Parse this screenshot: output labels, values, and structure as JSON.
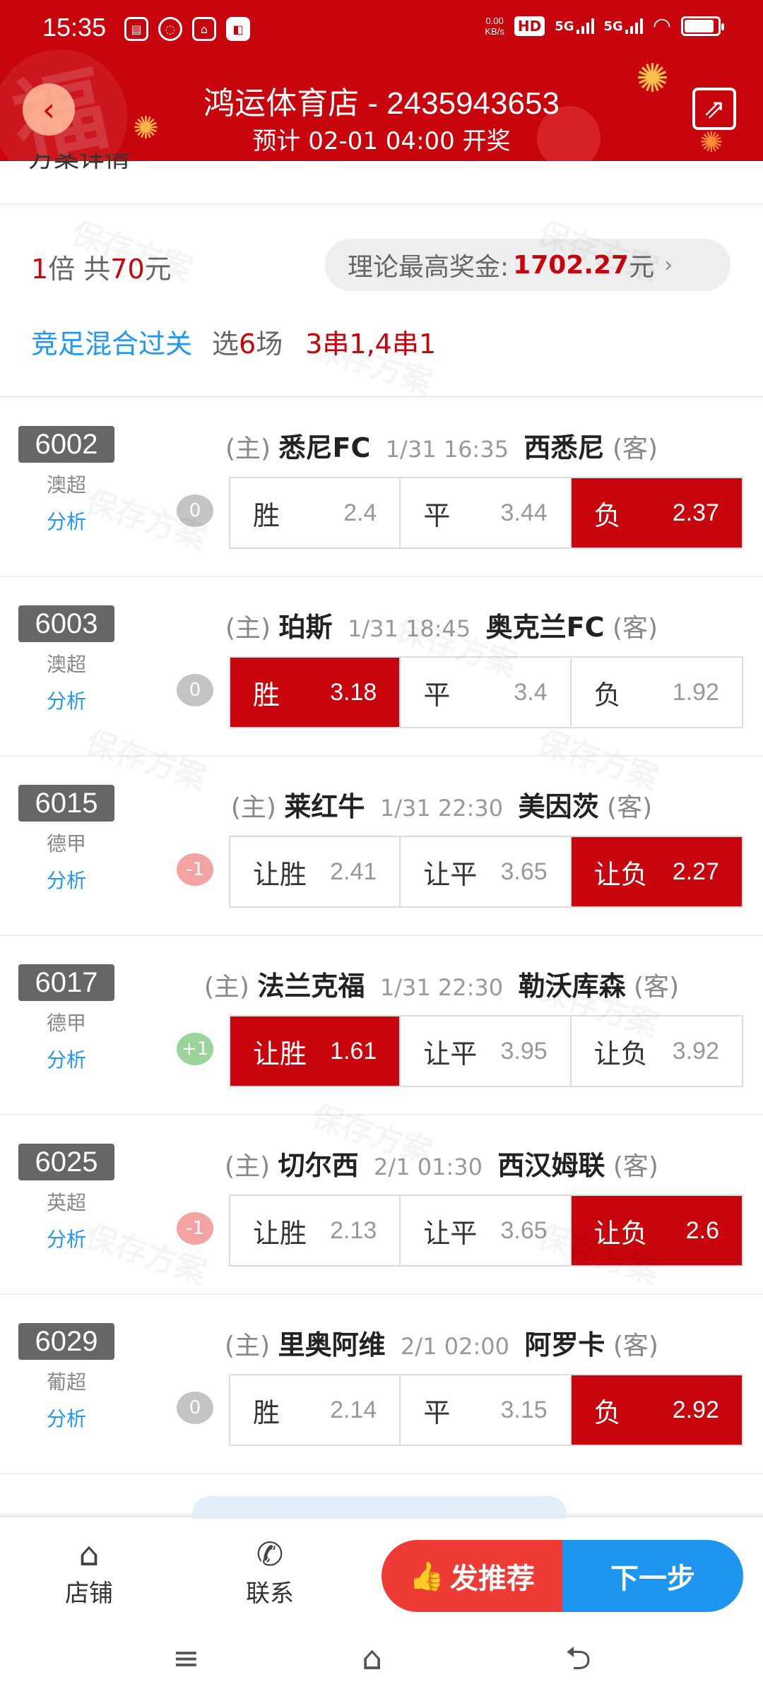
{
  "status_bar": {
    "time": "15:35",
    "speed_top": "0.00",
    "speed_bottom": "KB/s",
    "hd_label": "HD",
    "net1": "5G",
    "net2": "5G",
    "battery_percent": 90
  },
  "header": {
    "title": "鸿运体育店 - 2435943653",
    "subtitle": "预计 02-01 04:00 开奖",
    "section_cut": "方案详情"
  },
  "summary": {
    "multiplier": "1",
    "multiplier_unit": "倍 共",
    "total": "70",
    "total_unit": "元",
    "max_prize_label": "理论最高奖金:",
    "max_prize_value": "1702.27",
    "max_prize_unit": "元",
    "play_type": "竞足混合过关",
    "select_prefix": "选",
    "select_count": "6",
    "select_suffix": "场",
    "pass_type": "3串1,4串1"
  },
  "watermark": "保存方案",
  "matches": [
    {
      "code": "6002",
      "league": "澳超",
      "analysis": "分析",
      "home_tag": "(主)",
      "home": "悉尼FC",
      "time": "1/31 16:35",
      "away": "西悉尼",
      "away_tag": "(客)",
      "handicap": "0",
      "odds": [
        {
          "label": "胜",
          "value": "2.4",
          "selected": false
        },
        {
          "label": "平",
          "value": "3.44",
          "selected": false
        },
        {
          "label": "负",
          "value": "2.37",
          "selected": true
        }
      ]
    },
    {
      "code": "6003",
      "league": "澳超",
      "analysis": "分析",
      "home_tag": "(主)",
      "home": "珀斯",
      "time": "1/31 18:45",
      "away": "奥克兰FC",
      "away_tag": "(客)",
      "handicap": "0",
      "odds": [
        {
          "label": "胜",
          "value": "3.18",
          "selected": true
        },
        {
          "label": "平",
          "value": "3.4",
          "selected": false
        },
        {
          "label": "负",
          "value": "1.92",
          "selected": false
        }
      ]
    },
    {
      "code": "6015",
      "league": "德甲",
      "analysis": "分析",
      "home_tag": "(主)",
      "home": "莱红牛",
      "time": "1/31 22:30",
      "away": "美因茨",
      "away_tag": "(客)",
      "handicap": "-1",
      "odds": [
        {
          "label": "让胜",
          "value": "2.41",
          "selected": false
        },
        {
          "label": "让平",
          "value": "3.65",
          "selected": false
        },
        {
          "label": "让负",
          "value": "2.27",
          "selected": true
        }
      ]
    },
    {
      "code": "6017",
      "league": "德甲",
      "analysis": "分析",
      "home_tag": "(主)",
      "home": "法兰克福",
      "time": "1/31 22:30",
      "away": "勒沃库森",
      "away_tag": "(客)",
      "handicap": "+1",
      "odds": [
        {
          "label": "让胜",
          "value": "1.61",
          "selected": true
        },
        {
          "label": "让平",
          "value": "3.95",
          "selected": false
        },
        {
          "label": "让负",
          "value": "3.92",
          "selected": false
        }
      ]
    },
    {
      "code": "6025",
      "league": "英超",
      "analysis": "分析",
      "home_tag": "(主)",
      "home": "切尔西",
      "time": "2/1 01:30",
      "away": "西汉姆联",
      "away_tag": "(客)",
      "handicap": "-1",
      "odds": [
        {
          "label": "让胜",
          "value": "2.13",
          "selected": false
        },
        {
          "label": "让平",
          "value": "3.65",
          "selected": false
        },
        {
          "label": "让负",
          "value": "2.6",
          "selected": true
        }
      ]
    },
    {
      "code": "6029",
      "league": "葡超",
      "analysis": "分析",
      "home_tag": "(主)",
      "home": "里奥阿维",
      "time": "2/1 02:00",
      "away": "阿罗卡",
      "away_tag": "(客)",
      "handicap": "0",
      "odds": [
        {
          "label": "胜",
          "value": "2.14",
          "selected": false
        },
        {
          "label": "平",
          "value": "3.15",
          "selected": false
        },
        {
          "label": "负",
          "value": "2.92",
          "selected": true
        }
      ]
    }
  ],
  "bottom_bar": {
    "shop_label": "店铺",
    "contact_label": "联系",
    "recommend_label": "发推荐",
    "next_label": "下一步"
  },
  "colors": {
    "brand_red": "#c8040c",
    "accent_blue": "#1e96f0",
    "recommend_red": "#ef3b35"
  },
  "icons": {
    "back": "arrow-left-icon",
    "share": "share-icon",
    "shop": "home-icon",
    "contact": "phone-icon",
    "recommend": "thumbs-up-icon"
  }
}
